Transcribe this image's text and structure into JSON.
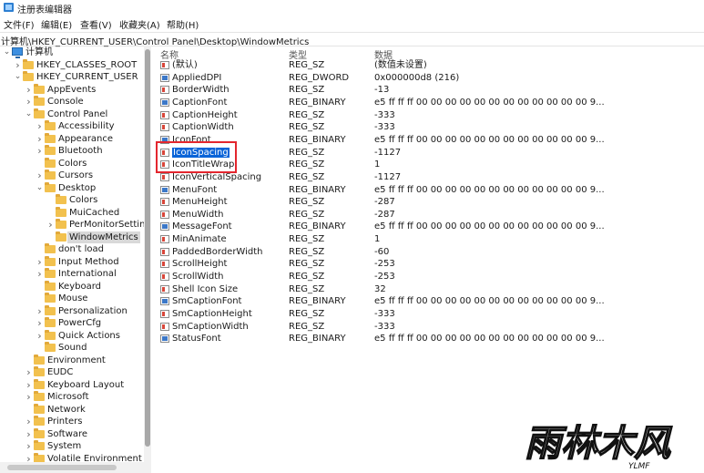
{
  "window": {
    "title": "注册表编辑器"
  },
  "menu": [
    "文件(F)",
    "编辑(E)",
    "查看(V)",
    "收藏夹(A)",
    "帮助(H)"
  ],
  "address": "计算机\\HKEY_CURRENT_USER\\Control Panel\\Desktop\\WindowMetrics",
  "tree": [
    {
      "label": "计算机",
      "depth": 0,
      "chev": "v",
      "icon": "pc"
    },
    {
      "label": "HKEY_CLASSES_ROOT",
      "depth": 1,
      "chev": ">"
    },
    {
      "label": "HKEY_CURRENT_USER",
      "depth": 1,
      "chev": "v"
    },
    {
      "label": "AppEvents",
      "depth": 2,
      "chev": ">"
    },
    {
      "label": "Console",
      "depth": 2,
      "chev": ">"
    },
    {
      "label": "Control Panel",
      "depth": 2,
      "chev": "v"
    },
    {
      "label": "Accessibility",
      "depth": 3,
      "chev": ">"
    },
    {
      "label": "Appearance",
      "depth": 3,
      "chev": ">"
    },
    {
      "label": "Bluetooth",
      "depth": 3,
      "chev": ">"
    },
    {
      "label": "Colors",
      "depth": 3,
      "chev": ""
    },
    {
      "label": "Cursors",
      "depth": 3,
      "chev": ">"
    },
    {
      "label": "Desktop",
      "depth": 3,
      "chev": "v"
    },
    {
      "label": "Colors",
      "depth": 4,
      "chev": ""
    },
    {
      "label": "MuiCached",
      "depth": 4,
      "chev": ""
    },
    {
      "label": "PerMonitorSettin",
      "depth": 4,
      "chev": ">"
    },
    {
      "label": "WindowMetrics",
      "depth": 4,
      "chev": "",
      "selected": true
    },
    {
      "label": "don't load",
      "depth": 3,
      "chev": ""
    },
    {
      "label": "Input Method",
      "depth": 3,
      "chev": ">"
    },
    {
      "label": "International",
      "depth": 3,
      "chev": ">"
    },
    {
      "label": "Keyboard",
      "depth": 3,
      "chev": ""
    },
    {
      "label": "Mouse",
      "depth": 3,
      "chev": ""
    },
    {
      "label": "Personalization",
      "depth": 3,
      "chev": ">"
    },
    {
      "label": "PowerCfg",
      "depth": 3,
      "chev": ">"
    },
    {
      "label": "Quick Actions",
      "depth": 3,
      "chev": ">"
    },
    {
      "label": "Sound",
      "depth": 3,
      "chev": ""
    },
    {
      "label": "Environment",
      "depth": 2,
      "chev": ""
    },
    {
      "label": "EUDC",
      "depth": 2,
      "chev": ">"
    },
    {
      "label": "Keyboard Layout",
      "depth": 2,
      "chev": ">"
    },
    {
      "label": "Microsoft",
      "depth": 2,
      "chev": ">"
    },
    {
      "label": "Network",
      "depth": 2,
      "chev": ""
    },
    {
      "label": "Printers",
      "depth": 2,
      "chev": ">"
    },
    {
      "label": "Software",
      "depth": 2,
      "chev": ">"
    },
    {
      "label": "System",
      "depth": 2,
      "chev": ">"
    },
    {
      "label": "Volatile Environment",
      "depth": 2,
      "chev": ">"
    }
  ],
  "columns": {
    "name": "名称",
    "type": "类型",
    "data": "数据"
  },
  "values": [
    {
      "name": "(默认)",
      "type": "REG_SZ",
      "data": "(数值未设置)",
      "kind": "sz"
    },
    {
      "name": "AppliedDPI",
      "type": "REG_DWORD",
      "data": "0x000000d8 (216)",
      "kind": "bin"
    },
    {
      "name": "BorderWidth",
      "type": "REG_SZ",
      "data": "-13",
      "kind": "sz"
    },
    {
      "name": "CaptionFont",
      "type": "REG_BINARY",
      "data": "e5 ff ff ff 00 00 00 00 00 00 00 00 00 00 00 00 9...",
      "kind": "bin"
    },
    {
      "name": "CaptionHeight",
      "type": "REG_SZ",
      "data": "-333",
      "kind": "sz"
    },
    {
      "name": "CaptionWidth",
      "type": "REG_SZ",
      "data": "-333",
      "kind": "sz"
    },
    {
      "name": "IconFont",
      "type": "REG_BINARY",
      "data": "e5 ff ff ff 00 00 00 00 00 00 00 00 00 00 00 00 9...",
      "kind": "bin"
    },
    {
      "name": "IconSpacing",
      "type": "REG_SZ",
      "data": "-1127",
      "kind": "sz",
      "selected": true
    },
    {
      "name": "IconTitleWrap",
      "type": "REG_SZ",
      "data": "1",
      "kind": "sz"
    },
    {
      "name": "IconVerticalSpacing",
      "type": "REG_SZ",
      "data": "-1127",
      "kind": "sz"
    },
    {
      "name": "MenuFont",
      "type": "REG_BINARY",
      "data": "e5 ff ff ff 00 00 00 00 00 00 00 00 00 00 00 00 9...",
      "kind": "bin"
    },
    {
      "name": "MenuHeight",
      "type": "REG_SZ",
      "data": "-287",
      "kind": "sz"
    },
    {
      "name": "MenuWidth",
      "type": "REG_SZ",
      "data": "-287",
      "kind": "sz"
    },
    {
      "name": "MessageFont",
      "type": "REG_BINARY",
      "data": "e5 ff ff ff 00 00 00 00 00 00 00 00 00 00 00 00 9...",
      "kind": "bin"
    },
    {
      "name": "MinAnimate",
      "type": "REG_SZ",
      "data": "1",
      "kind": "sz"
    },
    {
      "name": "PaddedBorderWidth",
      "type": "REG_SZ",
      "data": "-60",
      "kind": "sz"
    },
    {
      "name": "ScrollHeight",
      "type": "REG_SZ",
      "data": "-253",
      "kind": "sz"
    },
    {
      "name": "ScrollWidth",
      "type": "REG_SZ",
      "data": "-253",
      "kind": "sz"
    },
    {
      "name": "Shell Icon Size",
      "type": "REG_SZ",
      "data": "32",
      "kind": "sz"
    },
    {
      "name": "SmCaptionFont",
      "type": "REG_BINARY",
      "data": "e5 ff ff ff 00 00 00 00 00 00 00 00 00 00 00 00 9...",
      "kind": "bin"
    },
    {
      "name": "SmCaptionHeight",
      "type": "REG_SZ",
      "data": "-333",
      "kind": "sz"
    },
    {
      "name": "SmCaptionWidth",
      "type": "REG_SZ",
      "data": "-333",
      "kind": "sz"
    },
    {
      "name": "StatusFont",
      "type": "REG_BINARY",
      "data": "e5 ff ff ff 00 00 00 00 00 00 00 00 00 00 00 00 9...",
      "kind": "bin"
    }
  ],
  "watermark": {
    "logo_text": "雨林木风",
    "sub_text": "YLMF"
  },
  "colors": {
    "selection": "#0a64d8",
    "highlight_box": "#e3262e",
    "folder": "#f2c14e"
  }
}
